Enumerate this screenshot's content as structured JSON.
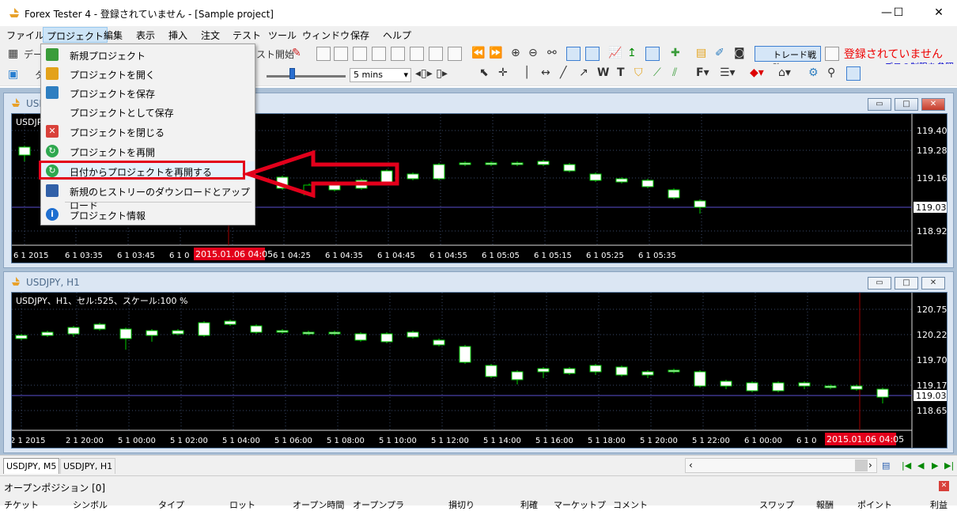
{
  "window": {
    "title": "Forex Tester 4 - 登録されていません - [Sample project]",
    "minimize": "—",
    "maximize": "☐",
    "close": "✕"
  },
  "menubar": {
    "items": [
      "ファイル",
      "プロジェクト",
      "編集",
      "表示",
      "挿入",
      "注文",
      "テスト",
      "ツール",
      "ウィンドウ",
      "保存",
      "ヘルプ"
    ],
    "active": "プロジェクト"
  },
  "toolbar": {
    "data_label": "デー",
    "test_start": "スト開始",
    "trade_strategy": "トレード戦略",
    "speed_value": "5 mins",
    "unregistered": "登録されていません",
    "demo_limits": "デモの制限を参照"
  },
  "dropdown": {
    "items": [
      {
        "label": "新規プロジェクト",
        "icon": "new-project-icon",
        "color": "#3a9c3a"
      },
      {
        "label": "プロジェクトを開く",
        "icon": "open-project-icon",
        "color": "#e3a21a"
      },
      {
        "label": "プロジェクトを保存",
        "icon": "save-project-icon",
        "color": "#2f7fc1"
      },
      {
        "label": "プロジェクトとして保存",
        "icon": "save-as-icon",
        "color": "#f2f2f2"
      },
      {
        "label": "プロジェクトを閉じる",
        "icon": "close-project-icon",
        "color": "#d9413a"
      },
      {
        "label": "プロジェクトを再開",
        "icon": "restart-project-icon",
        "color": "#2fa84f"
      },
      {
        "label": "日付からプロジェクトを再開する",
        "icon": "restart-from-date-icon",
        "color": "#2fa84f"
      },
      {
        "label": "新規のヒストリーのダウンロードとアップロード",
        "icon": "history-download-icon",
        "color": "#3160a8"
      },
      {
        "label": "プロジェクト情報",
        "icon": "info-icon",
        "color": "#1f6fd0"
      }
    ]
  },
  "chart_m5": {
    "caption": "USD",
    "label": "USDJPY",
    "price_axis": [
      "119.400",
      "119.280",
      "119.160",
      "119.030",
      "118.920"
    ],
    "current_price": "119.030",
    "time_axis": [
      "6 1 2015",
      "6 1 03:35",
      "6 1 03:45",
      "6 1 0",
      "6 1 04:15",
      "6 1 04:25",
      "6 1 04:35",
      "6 1 04:45",
      "6 1 04:55",
      "6 1 05:05",
      "6 1 05:15",
      "6 1 05:25",
      "6 1 05:35"
    ],
    "cursor_time": "2015.01.06 04:05"
  },
  "chart_h1": {
    "caption": "USDJPY, H1",
    "label": "USDJPY、H1、セル:525、スケール:100 %",
    "price_axis": [
      "120.750",
      "120.225",
      "119.700",
      "119.175",
      "118.650"
    ],
    "current_price": "119.030",
    "time_axis": [
      "2 1 2015",
      "2 1 20:00",
      "5 1 00:00",
      "5 1 02:00",
      "5 1 04:00",
      "5 1 06:00",
      "5 1 08:00",
      "5 1 10:00",
      "5 1 12:00",
      "5 1 14:00",
      "5 1 16:00",
      "5 1 18:00",
      "5 1 20:00",
      "5 1 22:00",
      "6 1 00:00",
      "6 1 0"
    ],
    "cursor_time": "2015.01.06 04:05"
  },
  "tabs": [
    "USDJPY, M5",
    "USDJPY, H1"
  ],
  "positions": {
    "title": "オープンポジション [0]",
    "columns": [
      "チケット",
      "シンボル",
      "タイプ",
      "ロット",
      "オープン時間",
      "オープンプラ",
      "損切り",
      "利確",
      "マーケットプ",
      "コメント",
      "スワップ",
      "報酬",
      "ポイント",
      "利益"
    ]
  },
  "colors": {
    "chart_bg": "#000000",
    "bull": "#ffffff",
    "bear": "#000000",
    "wick": "#00cc00",
    "grid": "#3a4a6a",
    "highlight": "#e3001b",
    "mdi_bg": "#abc0d6"
  }
}
